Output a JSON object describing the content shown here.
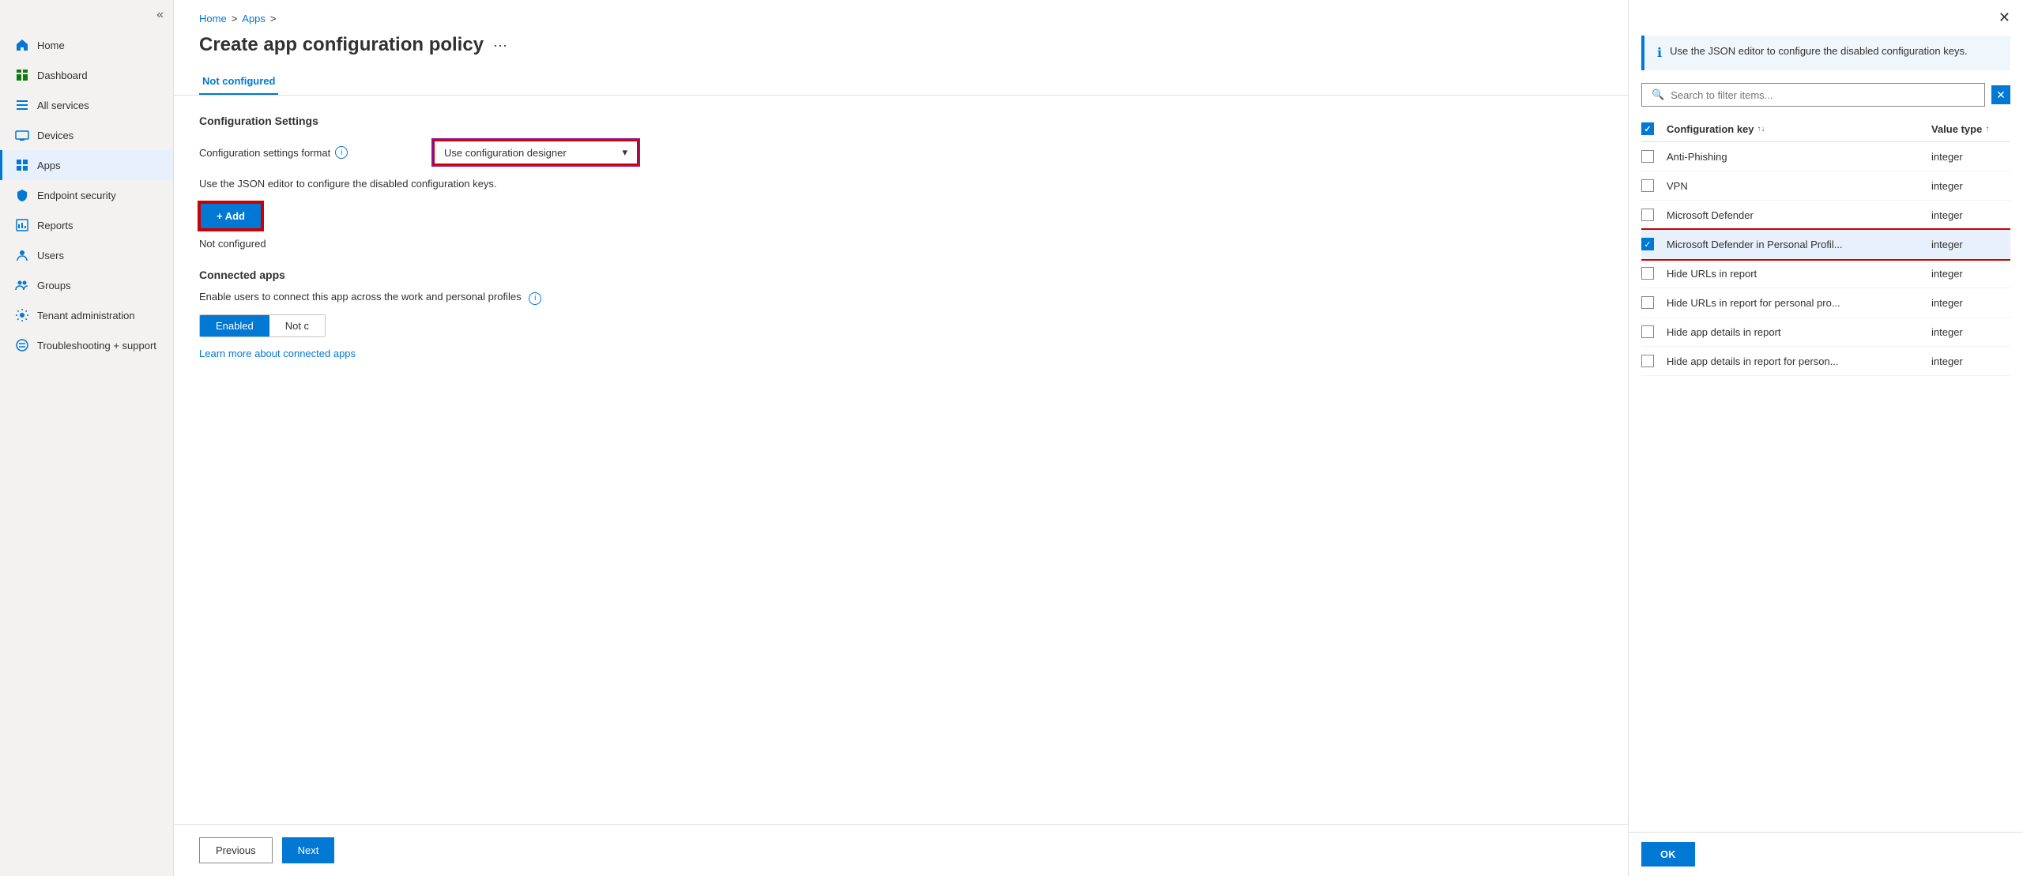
{
  "sidebar": {
    "collapse_icon": "«",
    "items": [
      {
        "id": "home",
        "label": "Home",
        "icon": "home"
      },
      {
        "id": "dashboard",
        "label": "Dashboard",
        "icon": "dashboard"
      },
      {
        "id": "all-services",
        "label": "All services",
        "icon": "all-services"
      },
      {
        "id": "devices",
        "label": "Devices",
        "icon": "devices"
      },
      {
        "id": "apps",
        "label": "Apps",
        "icon": "apps",
        "active": true
      },
      {
        "id": "endpoint-security",
        "label": "Endpoint security",
        "icon": "endpoint-security"
      },
      {
        "id": "reports",
        "label": "Reports",
        "icon": "reports"
      },
      {
        "id": "users",
        "label": "Users",
        "icon": "users"
      },
      {
        "id": "groups",
        "label": "Groups",
        "icon": "groups"
      },
      {
        "id": "tenant-admin",
        "label": "Tenant administration",
        "icon": "tenant"
      },
      {
        "id": "troubleshooting",
        "label": "Troubleshooting + support",
        "icon": "troubleshooting"
      }
    ]
  },
  "breadcrumb": {
    "home": "Home",
    "apps": "Apps",
    "sep1": ">",
    "sep2": ">"
  },
  "page": {
    "title": "Create app configuration policy",
    "menu_icon": "···",
    "tab_active": "Not configured"
  },
  "tabs": [
    "Not configured"
  ],
  "form": {
    "section_title": "Configuration Settings",
    "format_label": "Configuration settings format",
    "format_value": "Use configuration designer",
    "json_note": "Use the JSON editor to configure the disabled configuration keys.",
    "add_label": "+ Add",
    "not_configured": "Not configured",
    "connected_apps_title": "Connected apps",
    "connected_apps_desc": "Enable users to connect this app across the work and personal profiles",
    "toggle_enabled": "Enabled",
    "toggle_not": "Not c",
    "learn_more": "Learn more about connected apps"
  },
  "footer": {
    "previous": "Previous",
    "next": "Next"
  },
  "panel": {
    "info_text": "Use the JSON editor to configure the disabled configuration keys.",
    "search_placeholder": "Search to filter items...",
    "col_key": "Configuration key",
    "col_type": "Value type",
    "ok_label": "OK",
    "rows": [
      {
        "id": "anti-phishing",
        "label": "Anti-Phishing",
        "type": "integer",
        "checked": false
      },
      {
        "id": "vpn",
        "label": "VPN",
        "type": "integer",
        "checked": false
      },
      {
        "id": "ms-defender",
        "label": "Microsoft Defender",
        "type": "integer",
        "checked": false
      },
      {
        "id": "ms-defender-personal",
        "label": "Microsoft Defender in Personal Profil...",
        "type": "integer",
        "checked": true,
        "highlighted": true
      },
      {
        "id": "hide-urls",
        "label": "Hide URLs in report",
        "type": "integer",
        "checked": false
      },
      {
        "id": "hide-urls-personal",
        "label": "Hide URLs in report for personal pro...",
        "type": "integer",
        "checked": false
      },
      {
        "id": "hide-app-details",
        "label": "Hide app details in report",
        "type": "integer",
        "checked": false
      },
      {
        "id": "hide-app-details-personal",
        "label": "Hide app details in report for person...",
        "type": "integer",
        "checked": false
      }
    ]
  }
}
